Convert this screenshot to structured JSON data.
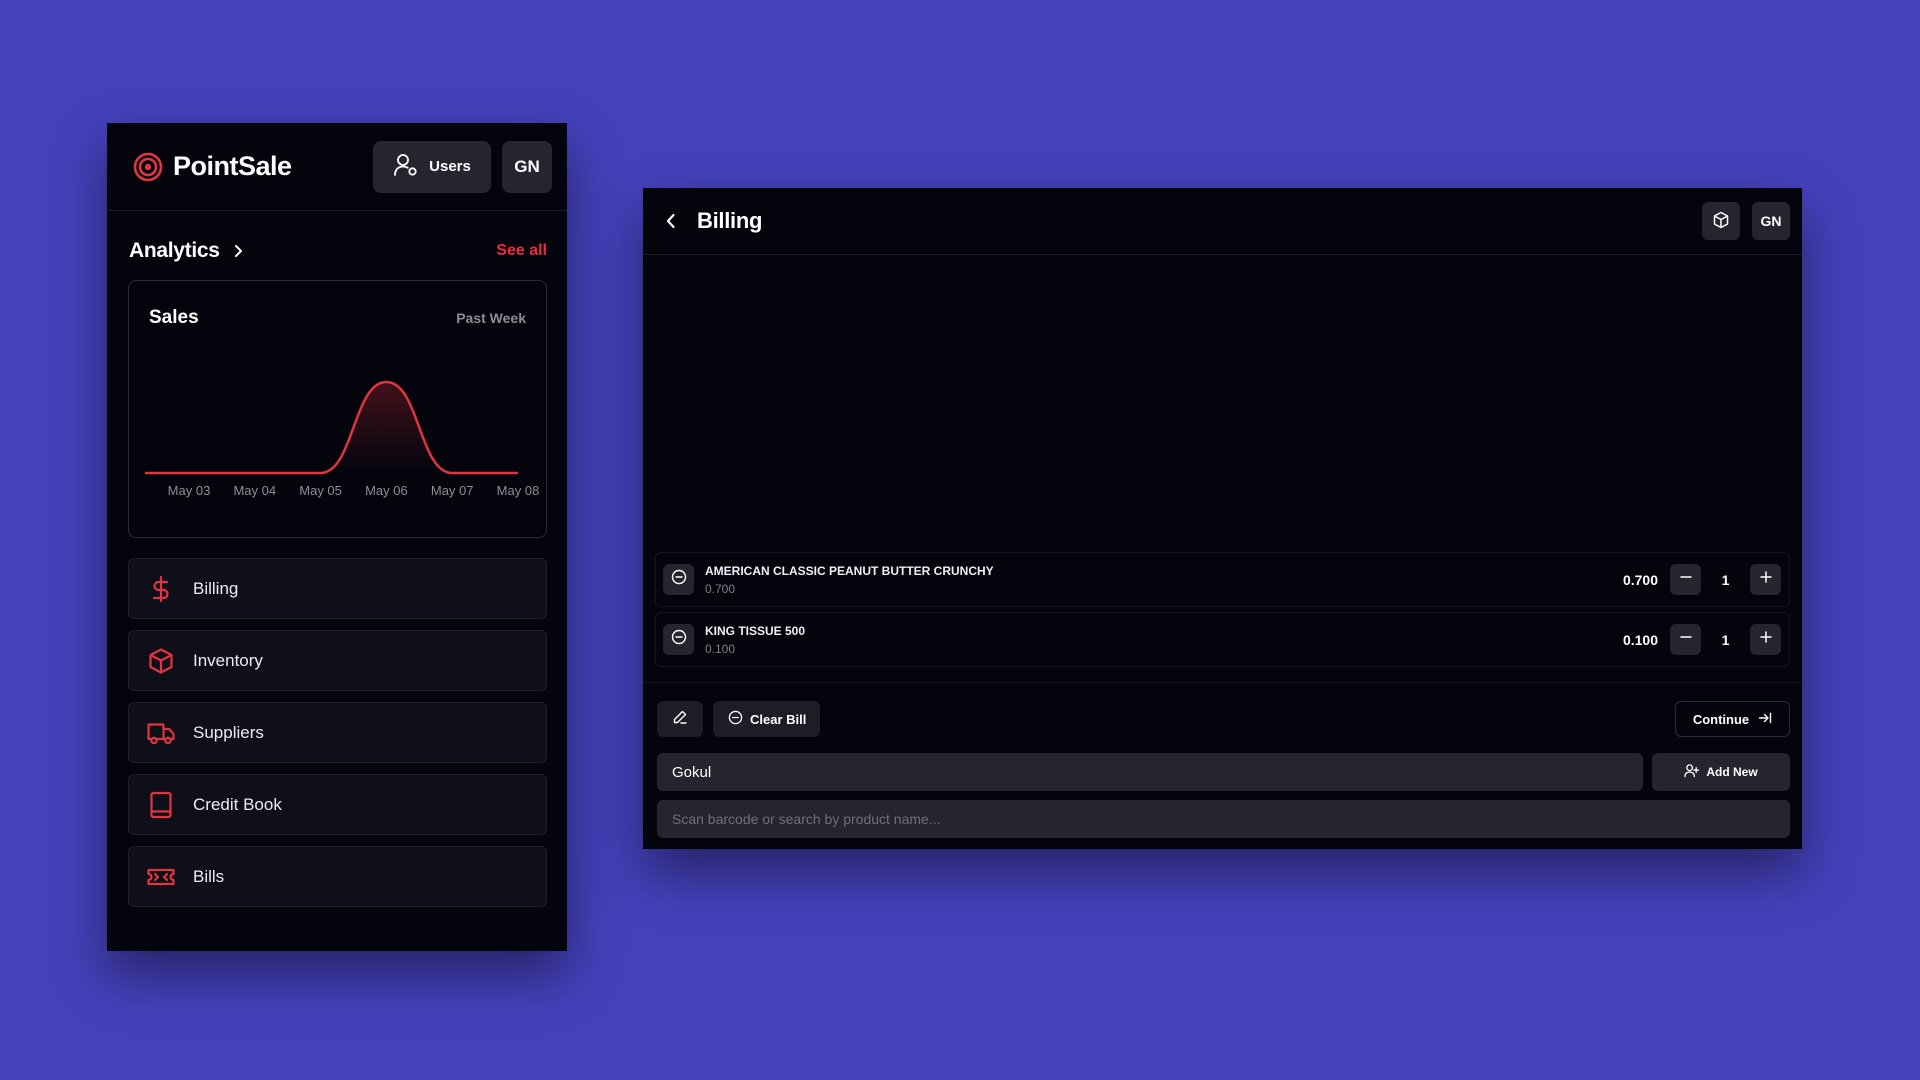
{
  "left_panel": {
    "app_name": "PointSale",
    "users_label": "Users",
    "user_initials": "GN",
    "analytics_title": "Analytics",
    "see_all_label": "See all",
    "sales_card": {
      "title": "Sales",
      "range": "Past Week"
    },
    "nav_items": [
      {
        "label": "Billing",
        "icon": "dollar-icon"
      },
      {
        "label": "Inventory",
        "icon": "box-icon"
      },
      {
        "label": "Suppliers",
        "icon": "truck-icon"
      },
      {
        "label": "Credit Book",
        "icon": "book-icon"
      },
      {
        "label": "Bills",
        "icon": "ticket-icon"
      }
    ]
  },
  "chart_data": {
    "type": "line",
    "title": "Sales",
    "subtitle": "Past Week",
    "categories": [
      "May 03",
      "May 04",
      "May 05",
      "May 06",
      "May 07",
      "May 08"
    ],
    "series": [
      {
        "values": [
          0,
          0,
          0,
          1,
          0,
          0
        ]
      }
    ],
    "color": "#e33442",
    "grid": false
  },
  "right_panel": {
    "title": "Billing",
    "user_initials": "GN",
    "items": [
      {
        "name": "AMERICAN CLASSIC PEANUT BUTTER CRUNCHY",
        "sub": "0.700",
        "price": "0.700",
        "qty": "1"
      },
      {
        "name": "KING TISSUE 500",
        "sub": "0.100",
        "price": "0.100",
        "qty": "1"
      }
    ],
    "clear_bill_label": "Clear Bill",
    "continue_label": "Continue",
    "customer_value": "Gokul",
    "add_new_label": "Add New",
    "search_placeholder": "Scan barcode or search by product name..."
  },
  "colors": {
    "background": "#4541bc",
    "panel": "#03040c",
    "accent_red": "#e33442",
    "link_red": "#ef2b3c"
  }
}
